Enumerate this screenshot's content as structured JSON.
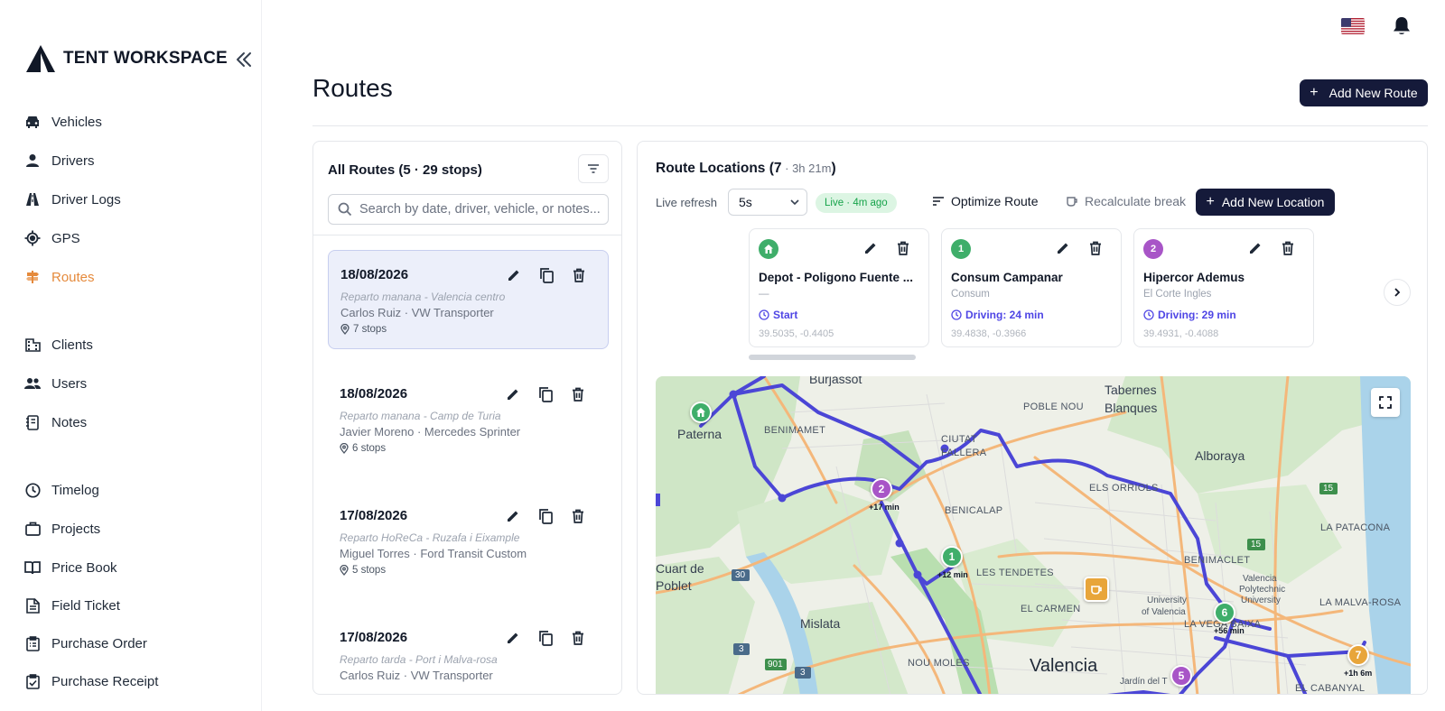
{
  "brand": {
    "name": "TENT WORKSPACE"
  },
  "nav": [
    {
      "id": "vehicles",
      "label": "Vehicles",
      "icon": "car-icon"
    },
    {
      "id": "drivers",
      "label": "Drivers",
      "icon": "person-icon"
    },
    {
      "id": "driver-logs",
      "label": "Driver Logs",
      "icon": "road-icon"
    },
    {
      "id": "gps",
      "label": "GPS",
      "icon": "gps-icon"
    },
    {
      "id": "routes",
      "label": "Routes",
      "icon": "signpost-icon",
      "active": true
    },
    {
      "id": "clients",
      "label": "Clients",
      "icon": "building-icon"
    },
    {
      "id": "users",
      "label": "Users",
      "icon": "users-icon"
    },
    {
      "id": "notes",
      "label": "Notes",
      "icon": "notes-icon"
    },
    {
      "id": "timelog",
      "label": "Timelog",
      "icon": "clock-icon"
    },
    {
      "id": "projects",
      "label": "Projects",
      "icon": "briefcase-icon"
    },
    {
      "id": "price-book",
      "label": "Price Book",
      "icon": "book-icon"
    },
    {
      "id": "field-ticket",
      "label": "Field Ticket",
      "icon": "document-icon"
    },
    {
      "id": "purchase-order",
      "label": "Purchase Order",
      "icon": "clipboard-icon"
    },
    {
      "id": "purchase-receipt",
      "label": "Purchase Receipt",
      "icon": "clipboard-check-icon"
    }
  ],
  "page": {
    "title": "Routes",
    "add_route_label": "Add New Route"
  },
  "routes_panel": {
    "title": "All Routes (5 · 29 stops)",
    "search_placeholder": "Search by date, driver, vehicle, or notes...",
    "routes": [
      {
        "date": "18/08/2026",
        "notes": "Reparto manana - Valencia centro",
        "driver": "Carlos Ruiz · VW Transporter",
        "stops": "7 stops",
        "selected": true
      },
      {
        "date": "18/08/2026",
        "notes": "Reparto manana - Camp de Turia",
        "driver": "Javier Moreno · Mercedes Sprinter",
        "stops": "6 stops"
      },
      {
        "date": "17/08/2026",
        "notes": "Reparto HoReCa - Ruzafa i Eixample",
        "driver": "Miguel Torres · Ford Transit Custom",
        "stops": "5 stops"
      },
      {
        "date": "17/08/2026",
        "notes": "Reparto tarda - Port i Malva-rosa",
        "driver": "Carlos Ruiz · VW Transporter",
        "stops": ""
      }
    ]
  },
  "locations_panel": {
    "title_main": "Route Locations (7",
    "title_sub": " · 3h 21m",
    "title_close": ")",
    "live_refresh_label": "Live refresh",
    "refresh_value": "5s",
    "live_badge": "Live · 4m ago",
    "optimize_label": "Optimize Route",
    "recalc_label": "Recalculate break",
    "add_location_label": "Add New Location",
    "stops": [
      {
        "num": "",
        "icon": "home-icon",
        "color": "#3fae6a",
        "name": "Depot - Poligono Fuente ...",
        "sub": "—",
        "drive": "Start",
        "coords": "39.5035, -0.4405"
      },
      {
        "num": "1",
        "color": "#3fae6a",
        "name": "Consum Campanar",
        "sub": "Consum",
        "drive": "Driving: 24 min",
        "coords": "39.4838, -0.3966"
      },
      {
        "num": "2",
        "color": "#a855c7",
        "name": "Hipercor Ademus",
        "sub": "El Corte Ingles",
        "drive": "Driving: 29 min",
        "coords": "39.4931, -0.4088"
      }
    ]
  },
  "map": {
    "labels": {
      "burjassot": "Burjassot",
      "paterna": "Paterna",
      "benimamet": "BENIMAMET",
      "poble_nou": "POBLE NOU",
      "tabernes": "Tabernes",
      "blanques": "Blanques",
      "ciutat": "CIUTAT",
      "fallera": "FALLERA",
      "alboraya": "Alboraya",
      "els_orriols": "ELS ORRIOLS",
      "benicalap": "BENICALAP",
      "la_patacona": "LA PATACONA",
      "cuart": "Cuart de",
      "poblet": "Poblet",
      "les_tendetes": "LES TENDETES",
      "benimaclet": "BENIMACLET",
      "el_carmen": "EL CARMEN",
      "university": "University",
      "of_valencia": "of Valencia",
      "upv1": "Valencia",
      "upv2": "Polytechnic",
      "upv3": "University",
      "la_malva_rosa": "LA MALVA-ROSA",
      "mislata": "Mislata",
      "la_vega": "LA VEGA BAIXA",
      "nou_moles": "NOU MOLES",
      "valencia": "Valencia",
      "jardin": "Jardín del T",
      "el_cabanyal": "EL CABANYAL",
      "road_15a": "15",
      "road_15b": "15",
      "road_30": "30",
      "road_3a": "3",
      "road_3b": "3",
      "road_901": "901"
    },
    "markers": [
      {
        "num": "",
        "icon": "home-icon",
        "color": "#3fae6a",
        "tag": ""
      },
      {
        "num": "2",
        "color": "#a855c7",
        "tag": "+17 min"
      },
      {
        "num": "1",
        "color": "#3fae6a",
        "tag": "+12 min"
      },
      {
        "num": "6",
        "color": "#3fae6a",
        "tag": "+56 min"
      },
      {
        "num": "7",
        "color": "#e8a53a",
        "tag": "+1h 6m"
      },
      {
        "num": "5",
        "color": "#a855c7",
        "tag": ""
      }
    ],
    "route_color": "#4b46d6"
  }
}
